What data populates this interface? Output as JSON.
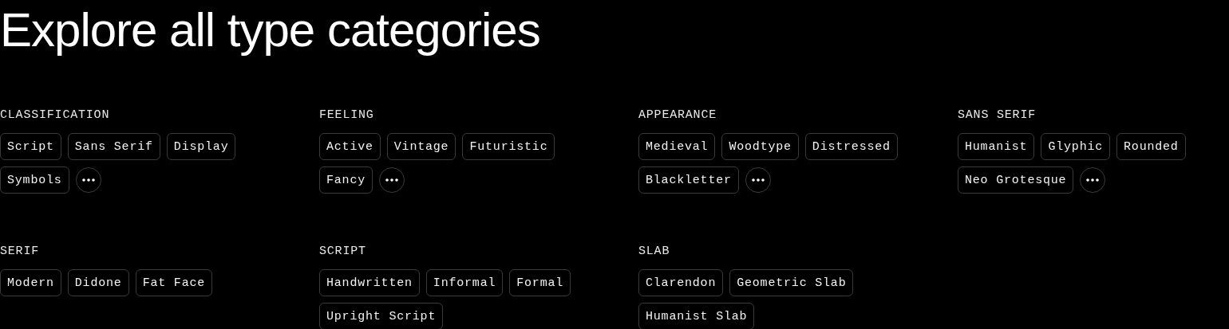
{
  "title": "Explore all type categories",
  "groups": [
    {
      "heading": "CLASSIFICATION",
      "tags": [
        "Script",
        "Sans Serif",
        "Display",
        "Symbols"
      ],
      "more_button": true
    },
    {
      "heading": "FEELING",
      "tags": [
        "Active",
        "Vintage",
        "Futuristic",
        "Fancy"
      ],
      "more_button": true
    },
    {
      "heading": "APPEARANCE",
      "tags": [
        "Medieval",
        "Woodtype",
        "Distressed",
        "Blackletter"
      ],
      "more_button": true
    },
    {
      "heading": "SANS SERIF",
      "tags": [
        "Humanist",
        "Glyphic",
        "Rounded",
        "Neo Grotesque"
      ],
      "more_button": true
    },
    {
      "heading": "SERIF",
      "tags": [
        "Modern",
        "Didone",
        "Fat Face"
      ],
      "more_button": false
    },
    {
      "heading": "SCRIPT",
      "tags": [
        "Handwritten",
        "Informal",
        "Formal",
        "Upright Script"
      ],
      "more_button": false
    },
    {
      "heading": "SLAB",
      "tags": [
        "Clarendon",
        "Geometric Slab",
        "Humanist Slab"
      ],
      "more_button": false
    }
  ]
}
